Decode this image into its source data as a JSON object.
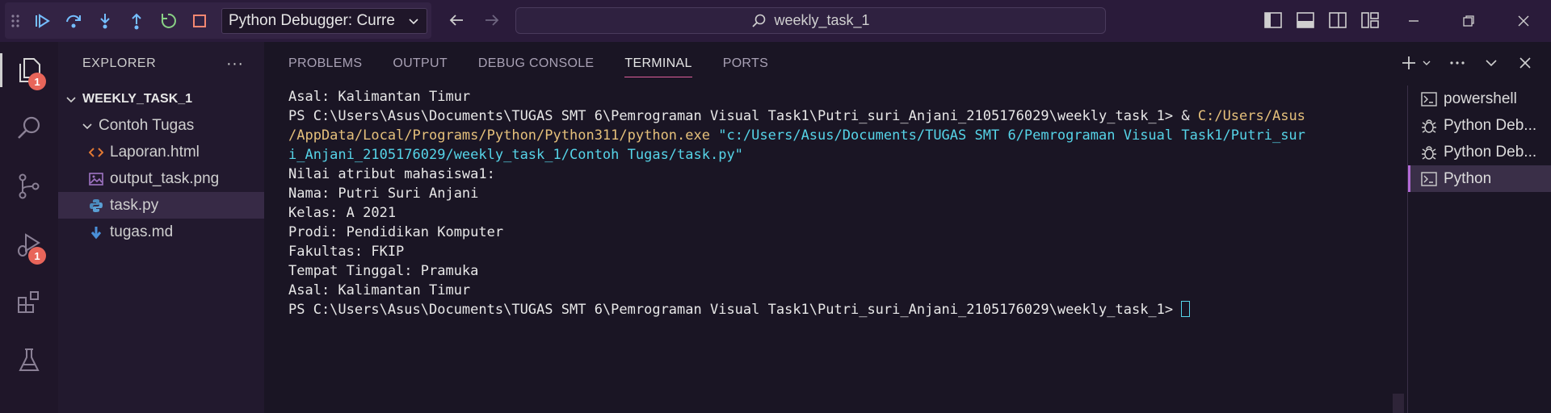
{
  "titlebar": {
    "debug_config": "Python Debugger: Curre",
    "search_text": "weekly_task_1"
  },
  "activity": {
    "explorer_badge": "1",
    "debug_badge": "1"
  },
  "explorer": {
    "header": "EXPLORER",
    "root": "WEEKLY_TASK_1",
    "folder": "Contoh Tugas",
    "files": [
      "Laporan.html",
      "output_task.png",
      "task.py",
      "tugas.md"
    ]
  },
  "panel": {
    "tabs": [
      "PROBLEMS",
      "OUTPUT",
      "DEBUG CONSOLE",
      "TERMINAL",
      "PORTS"
    ]
  },
  "terminal": {
    "l0": "Asal: Kalimantan Timur",
    "l1_prompt": "PS C:\\Users\\Asus\\Documents\\TUGAS SMT 6\\Pemrograman Visual Task1\\Putri_suri_Anjani_2105176029\\weekly_task_1> ",
    "l1_amp": "& ",
    "l1_exe_a": "C:/Users/Asus",
    "l2_exe_b": "/AppData/Local/Programs/Python/Python311/python.exe",
    "l2_arg": " \"c:/Users/Asus/Documents/TUGAS SMT 6/Pemrograman Visual Task1/Putri_sur",
    "l3_arg": "i_Anjani_2105176029/weekly_task_1/Contoh Tugas/task.py\"",
    "l4": "Nilai atribut mahasiswa1:",
    "l5": "Nama: Putri Suri Anjani",
    "l6": "Kelas: A 2021",
    "l7": "Prodi: Pendidikan Komputer",
    "l8": "Fakultas: FKIP",
    "l9": "Tempat Tinggal: Pramuka",
    "l10": "Asal: Kalimantan Timur",
    "l11_prompt": "PS C:\\Users\\Asus\\Documents\\TUGAS SMT 6\\Pemrograman Visual Task1\\Putri_suri_Anjani_2105176029\\weekly_task_1> "
  },
  "terminal_list": [
    "powershell",
    "Python Deb...",
    "Python Deb...",
    "Python"
  ]
}
